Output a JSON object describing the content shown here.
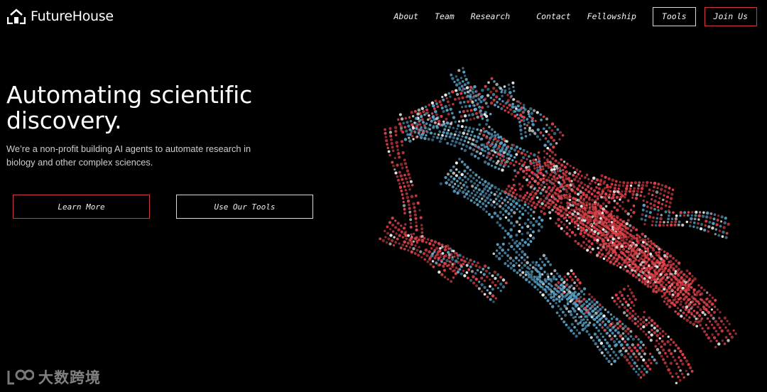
{
  "brand": {
    "name": "FutureHouse"
  },
  "nav": {
    "about": "About",
    "team": "Team",
    "research": "Research",
    "contact": "Contact",
    "fellowship": "Fellowship",
    "tools": "Tools",
    "join": "Join Us"
  },
  "hero": {
    "title": "Automating scientific discovery.",
    "subtitle": "We’re a non-profit building AI agents to automate research in biology and other complex sciences.",
    "learn_more": "Learn More",
    "use_tools": "Use Our Tools"
  },
  "watermark": {
    "text": "大数跨境"
  },
  "colors": {
    "background": "#000000",
    "accent_red": "#d0383e",
    "protein_red": "#e0424a",
    "protein_blue": "#5aa3c8",
    "protein_white": "#f0f0f0"
  }
}
